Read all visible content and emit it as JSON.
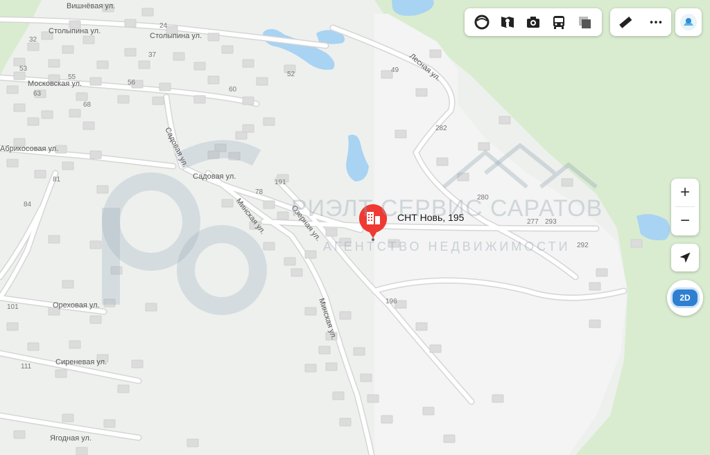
{
  "map": {
    "colors": {
      "land": "#eef0ee",
      "forest": "#d9ecd0",
      "water": "#a9d3f2",
      "road": "#ffffff",
      "building": "#dcdcdc",
      "pin": "#ee3a32"
    },
    "streets": [
      "Вишнёвая ул.",
      "Столыпина ул.",
      "Столыпина ул.",
      "Московская ул.",
      "Абрикосовая ул.",
      "Садовая ул.",
      "Садовая ул.",
      "Минская ул.",
      "Озерная ул.",
      "Ореховая ул.",
      "Сиреневая ул.",
      "Ягодная ул.",
      "Минская ул.",
      "Лесная ул."
    ],
    "house_numbers": [
      "24",
      "32",
      "37",
      "53",
      "55",
      "56",
      "52",
      "60",
      "63",
      "68",
      "49",
      "282",
      "81",
      "84",
      "78",
      "191",
      "280",
      "277",
      "293",
      "292",
      "196",
      "101",
      "111"
    ],
    "pin": {
      "label": "СНТ Новь, 195",
      "icon": "building-icon"
    },
    "watermark": {
      "title": "РИЭЛТ СЕРВИС САРАТОВ",
      "subtitle": "АГЕНТСТВО НЕДВИЖИМОСТИ"
    }
  },
  "toolbar": {
    "items": [
      "layers-icon",
      "panorama-icon",
      "photo-icon",
      "transport-icon",
      "layers-square-icon"
    ],
    "extra": [
      "ruler-icon",
      "more-icon"
    ]
  },
  "controls": {
    "zoom_in": "+",
    "zoom_out": "−",
    "mode": "2D"
  }
}
